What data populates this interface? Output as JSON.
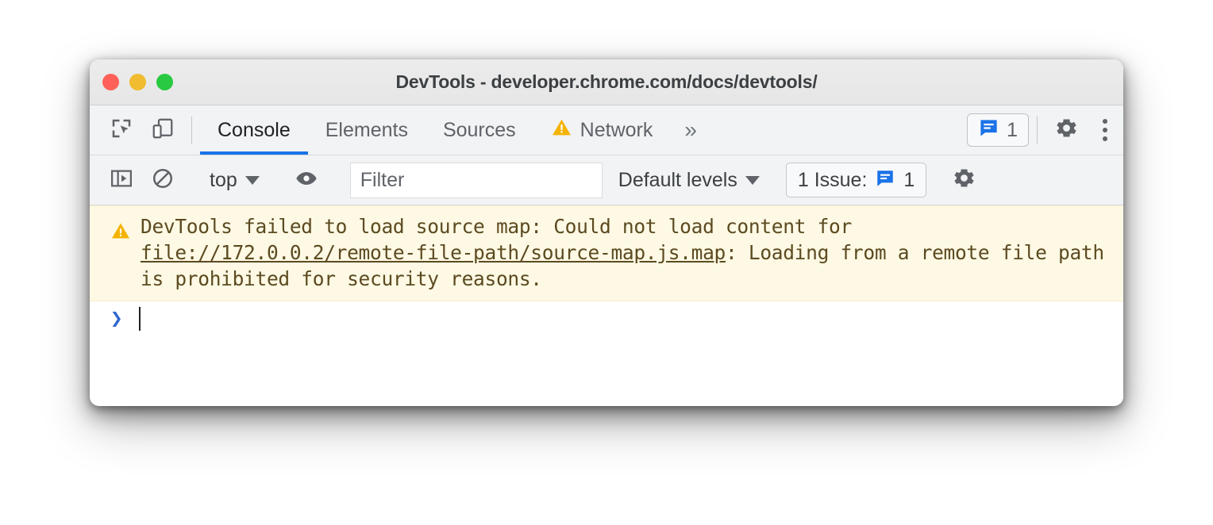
{
  "window": {
    "title": "DevTools - developer.chrome.com/docs/devtools/",
    "traffic_lights": [
      {
        "name": "close",
        "color": "#ff6158"
      },
      {
        "name": "minimize",
        "color": "#f1bc30"
      },
      {
        "name": "maximize",
        "color": "#29c941"
      }
    ]
  },
  "tabbar": {
    "inspect_icon": "inspect-element-icon",
    "device_icon": "device-toolbar-icon",
    "tabs": [
      {
        "label": "Console",
        "active": true,
        "warning": false
      },
      {
        "label": "Elements",
        "active": false,
        "warning": false
      },
      {
        "label": "Sources",
        "active": false,
        "warning": false
      },
      {
        "label": "Network",
        "active": false,
        "warning": true
      }
    ],
    "overflow_label": "»",
    "issues_badge": {
      "icon": "issues-bubble-icon",
      "count": "1"
    },
    "settings_icon": "gear-icon",
    "more_icon": "kebab-menu-icon",
    "active_tab_color": "#1a73e8"
  },
  "console_toolbar": {
    "sidebar_toggle_icon": "console-sidebar-icon",
    "clear_icon": "clear-console-icon",
    "context_selector": "top",
    "live_expression_icon": "eye-icon",
    "filter": {
      "placeholder": "Filter",
      "value": ""
    },
    "levels_selector": "Default levels",
    "issues_counter": {
      "label": "1 Issue:",
      "icon": "issues-bubble-icon",
      "count": "1"
    },
    "settings_icon": "gear-icon"
  },
  "console": {
    "warning": {
      "icon": "warning-triangle-icon",
      "icon_color": "#f5b300",
      "background": "#fdf9e4",
      "text_color": "#5c4a20",
      "prefix": "DevTools failed to load source map: Could not load content for ",
      "link": "file://172.0.0.2/remote-file-path/source-map.js.map",
      "suffix": ": Loading from a remote file path is prohibited for security reasons."
    },
    "prompt": {
      "chevron": "❯",
      "chevron_color": "#3068d0",
      "value": ""
    }
  }
}
